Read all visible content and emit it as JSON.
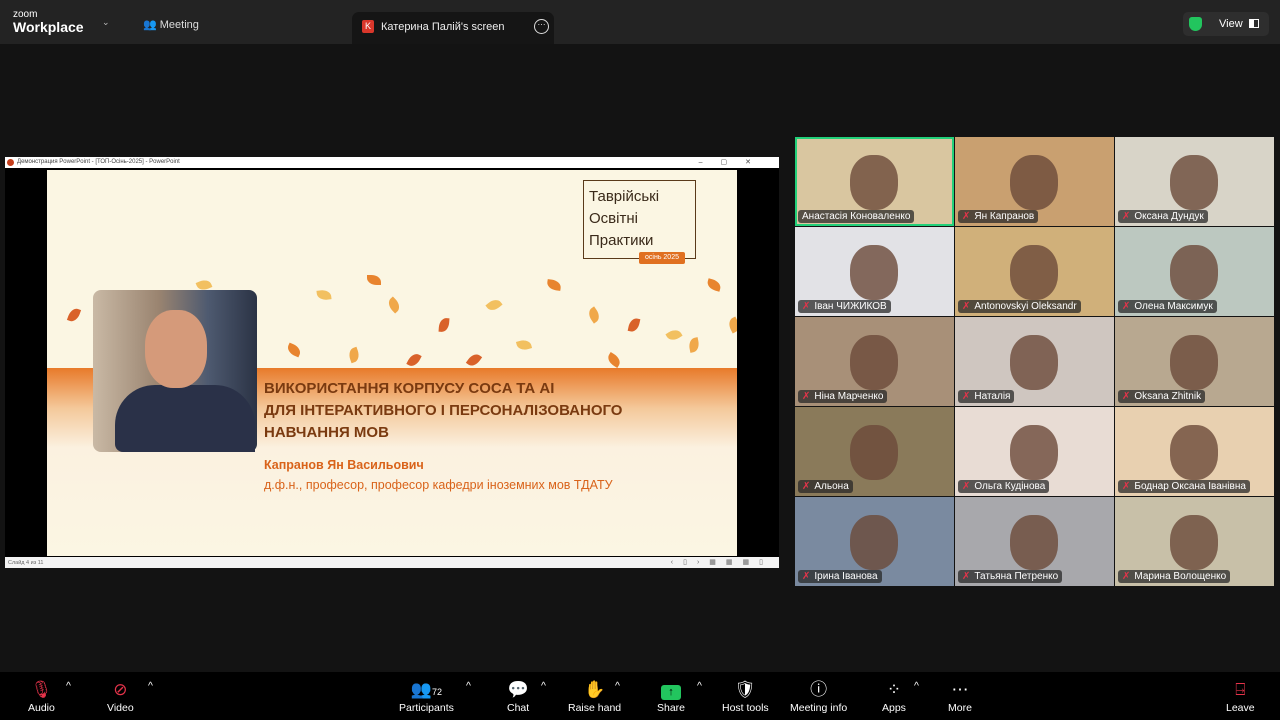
{
  "app": {
    "logo_small": "zoom",
    "logo_big": "Workplace",
    "meeting_label": "Meeting",
    "view_label": "View"
  },
  "share_tab": {
    "avatar_letter": "K",
    "title": "Катерина Палій's screen"
  },
  "powerpoint": {
    "window_title": "Демонстрация PowerPoint - [ТОП-Осінь-2025] - PowerPoint",
    "status": "Слайд 4 из 11"
  },
  "slide": {
    "brand_lines": [
      "Таврійські",
      "Освітні",
      "Практики"
    ],
    "brand_badge": "осінь 2025",
    "title_lines": [
      "ВИКОРИСТАННЯ КОРПУСУ COCA ТА AI",
      "ДЛЯ ІНТЕРАКТИВНОГО І ПЕРСОНАЛІЗОВАНОГО",
      "НАВЧАННЯ МОВ"
    ],
    "speaker": "Капранов Ян Васильович",
    "role": "д.ф.н., професор, професор кафедри іноземних мов ТДАТУ",
    "colors": {
      "accent": "#e07020",
      "bg": "#fbf6e3"
    }
  },
  "participants": [
    {
      "name": "Анастасія Коноваленко",
      "muted": false,
      "active": true,
      "bg": "#d9c6a0"
    },
    {
      "name": "Ян Капранов",
      "muted": true,
      "bg": "#c9a070"
    },
    {
      "name": "Оксана Дундук",
      "muted": true,
      "bg": "#d8d4c8"
    },
    {
      "name": "Іван ЧИЖИКОВ",
      "muted": true,
      "bg": "#e2e2e6"
    },
    {
      "name": "Antonovskyi Oleksandr",
      "muted": true,
      "bg": "#d0b07a"
    },
    {
      "name": "Олена Максимук",
      "muted": true,
      "bg": "#bcc8c0"
    },
    {
      "name": "Ніна Марченко",
      "muted": true,
      "bg": "#a89078"
    },
    {
      "name": "Наталія",
      "muted": true,
      "bg": "#cfc6c0"
    },
    {
      "name": "Oksana Zhitnik",
      "muted": true,
      "bg": "#b8a890"
    },
    {
      "name": "Альона",
      "muted": true,
      "bg": "#8a7a5a"
    },
    {
      "name": "Ольга Кудінова",
      "muted": true,
      "bg": "#e8dcd4"
    },
    {
      "name": "Боднар Оксана Іванівна",
      "muted": true,
      "bg": "#e8d0b0"
    },
    {
      "name": "Ірина Іванова",
      "muted": true,
      "bg": "#7a8aa0"
    },
    {
      "name": "Татьяна Петренко",
      "muted": true,
      "bg": "#a8a8ac"
    },
    {
      "name": "Марина Волощенко",
      "muted": true,
      "bg": "#c8c0a8"
    }
  ],
  "toolbar": {
    "audio": "Audio",
    "video": "Video",
    "participants": "Participants",
    "participant_count": "72",
    "chat": "Chat",
    "raise_hand": "Raise hand",
    "share": "Share",
    "host_tools": "Host tools",
    "meeting_info": "Meeting info",
    "apps": "Apps",
    "more": "More",
    "leave": "Leave"
  }
}
